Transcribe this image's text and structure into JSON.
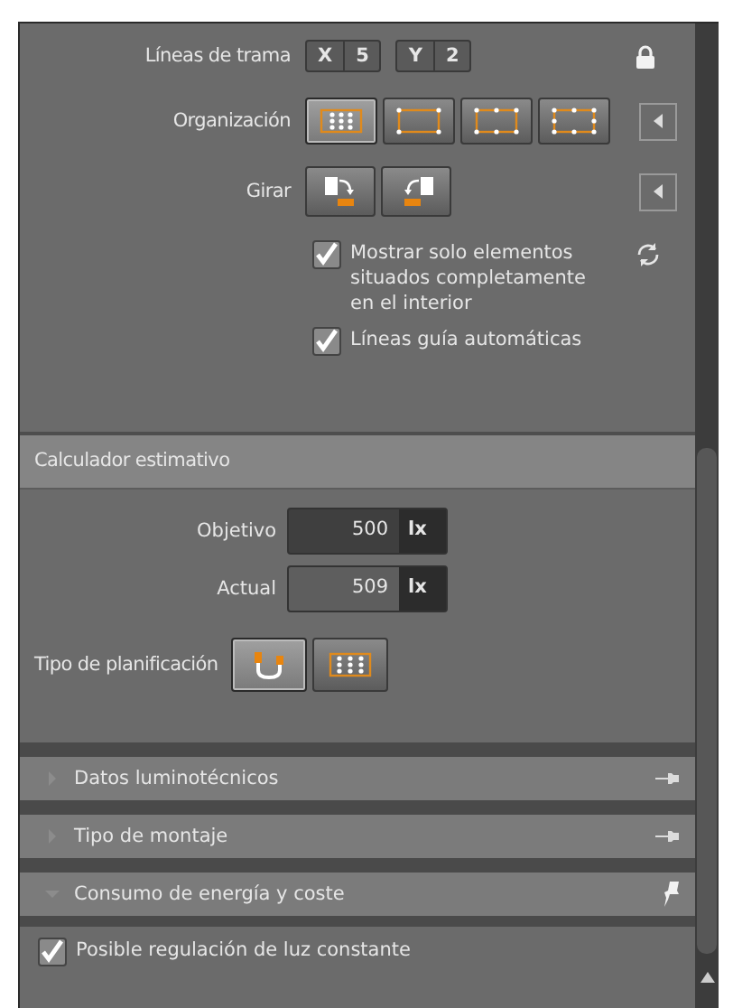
{
  "grid_lines": {
    "label": "Líneas de trama",
    "x_label": "X",
    "x_value": "5",
    "y_label": "Y",
    "y_value": "2",
    "locked": true
  },
  "organization": {
    "label": "Organización",
    "options": [
      {
        "kind": "grid",
        "selected": true
      },
      {
        "kind": "corners",
        "selected": false
      },
      {
        "kind": "edges",
        "selected": false
      },
      {
        "kind": "perimeter",
        "selected": false
      }
    ]
  },
  "rotate": {
    "label": "Girar",
    "options": [
      {
        "kind": "cw"
      },
      {
        "kind": "ccw"
      }
    ]
  },
  "checkboxes": [
    {
      "label": "Mostrar solo elementos situados completamente en el interior",
      "checked": true
    },
    {
      "label": "Líneas guía automáticas",
      "checked": true
    }
  ],
  "estimator": {
    "title": "Calculador estimativo",
    "fields": [
      {
        "label": "Objetivo",
        "value": "500",
        "unit": "lx",
        "editable": true
      },
      {
        "label": "Actual",
        "value": "509",
        "unit": "lx",
        "editable": false
      }
    ],
    "planning": {
      "label": "Tipo de planificación",
      "options": [
        {
          "kind": "single",
          "selected": true
        },
        {
          "kind": "grid",
          "selected": false
        }
      ]
    }
  },
  "sections": [
    {
      "title": "Datos luminotécnicos",
      "expanded": false,
      "pinned": false
    },
    {
      "title": "Tipo de montaje",
      "expanded": false,
      "pinned": false
    },
    {
      "title": "Consumo de energía y coste",
      "expanded": true,
      "pinned": true
    }
  ],
  "energy_options": [
    {
      "label": "Posible regulación de luz constante",
      "checked": true
    }
  ]
}
